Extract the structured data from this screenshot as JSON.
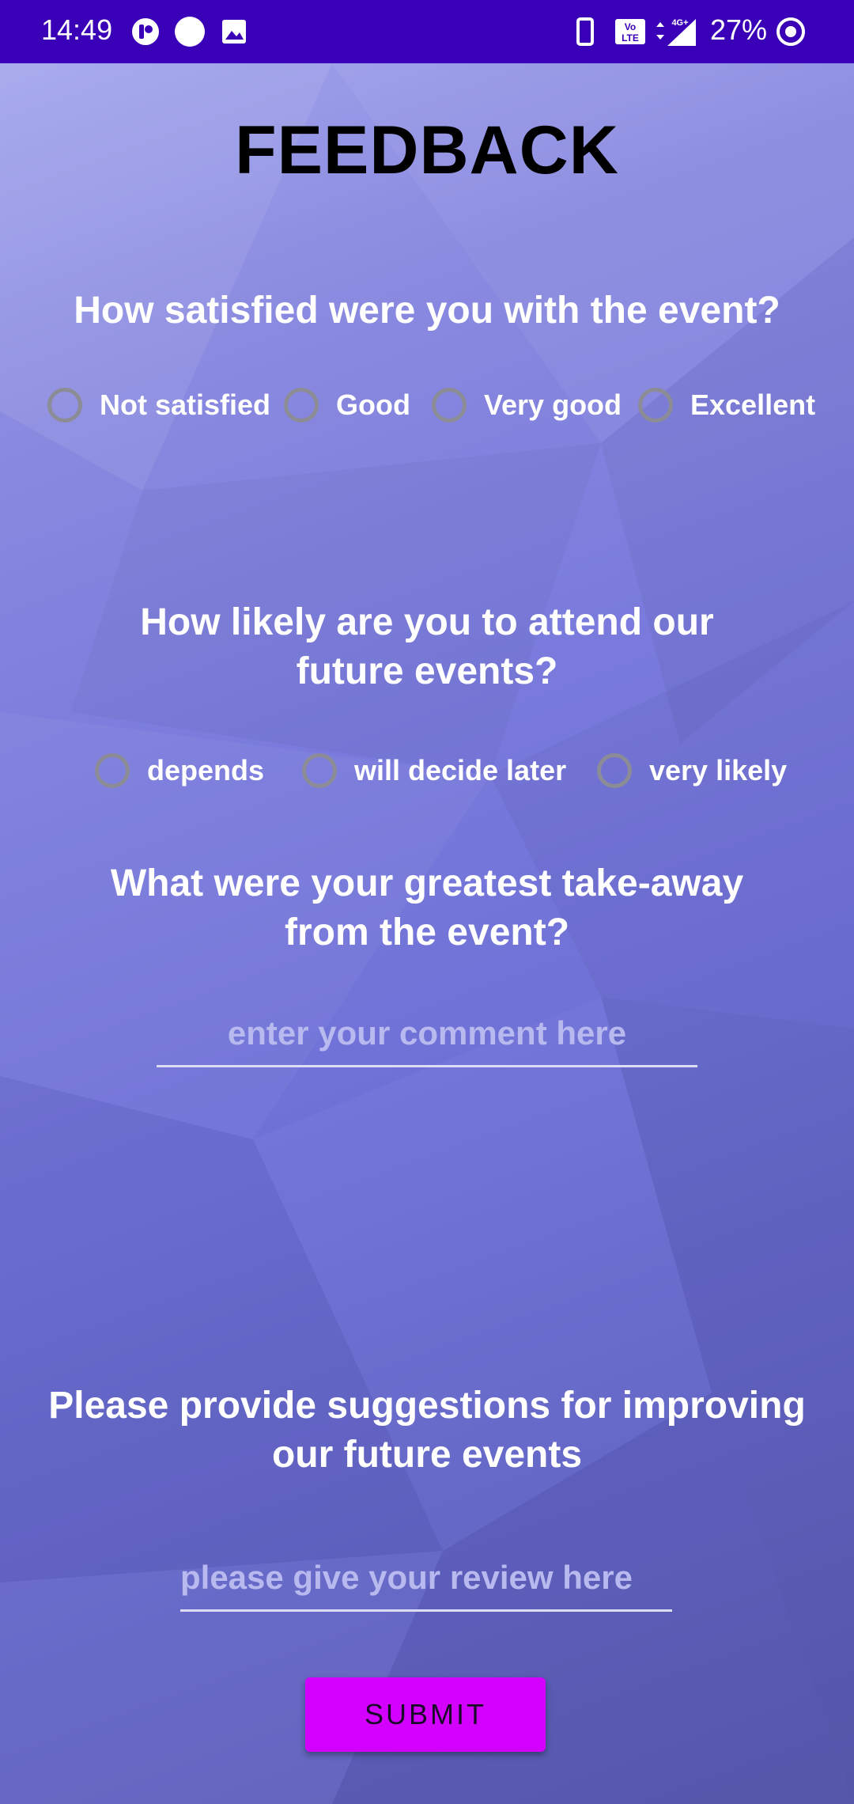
{
  "status_bar": {
    "time": "14:49",
    "battery": "27%",
    "icons": [
      "notification-app-icon",
      "notification-dot-icon",
      "gallery-icon",
      "vibrate-icon",
      "volte-icon",
      "signal-4g-icon",
      "data-saver-icon"
    ],
    "network_badge": "4G+",
    "volte_badge": "Vo LTE",
    "background": "#3a00b8"
  },
  "page": {
    "title": "FEEDBACK",
    "accent_color": "#d400ff"
  },
  "question1": {
    "text": "How satisfied were you with the event?",
    "options": [
      "Not satisfied",
      "Good",
      "Very good",
      "Excellent"
    ]
  },
  "question2": {
    "text": "How likely are you to attend our future events?",
    "options": [
      "depends",
      "will decide later",
      "very likely"
    ]
  },
  "question3": {
    "text": "What were your greatest take-away from the event?",
    "placeholder": "enter your comment here"
  },
  "question4": {
    "text": "Please provide suggestions for improving our future events",
    "placeholder": "please give your review here"
  },
  "submit": {
    "label": "SUBMIT"
  }
}
